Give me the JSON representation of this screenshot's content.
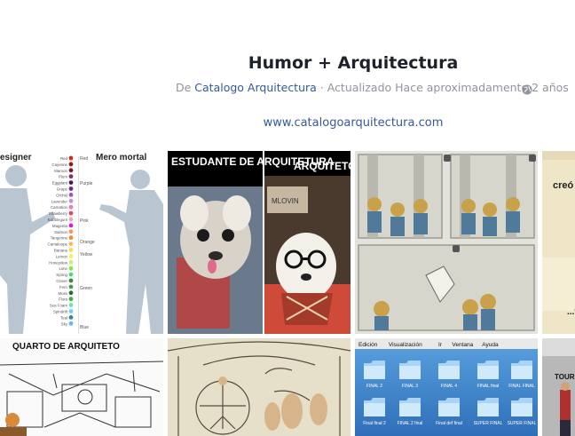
{
  "album": {
    "title": "Humor + Arquitectura",
    "meta_prefix": "De ",
    "author": "Catalogo Arquitectura",
    "meta_suffix": " · Actualizado Hace aproximadamente 2 años",
    "privacy_icon": "globe-icon",
    "website": "www.catalogoarquitectura.com"
  },
  "photos": [
    {
      "labels": [
        "esigner",
        "Mero mortal"
      ],
      "color_names": [
        "Red",
        "Cayenne",
        "Maroon",
        "Plum",
        "Eggplant",
        "Grape",
        "Orchid",
        "Lavender",
        "Carnation",
        "Strawberry",
        "Bubblegum",
        "Magenta",
        "Salmon",
        "Tangerine",
        "Cantaloupe",
        "Banana",
        "Lemon",
        "Honeydew",
        "Lime",
        "Spring",
        "Clover",
        "Fern",
        "Moss",
        "Flora",
        "Sea Foam",
        "Spindrift",
        "Teal",
        "Sky"
      ],
      "right_words": [
        "Red",
        "Purple",
        "Pink",
        "Orange",
        "Yellow",
        "Green",
        "Blue"
      ]
    },
    {
      "left_caption": "ESTUDANTE DE ARQUITETURA",
      "right_caption": "ARQUITETO",
      "sign_text": "MLOVIN"
    },
    {
      "description": "comic"
    },
    {
      "caption": "creó",
      "footer": "...f"
    },
    {
      "caption": "QUARTO DE ARQUITETO"
    },
    {
      "description": "sketch"
    },
    {
      "menu": [
        "Edición",
        "Visualización",
        "Ir",
        "Ventana",
        "Ayuda"
      ],
      "folders_row1": [
        "FINAL 2",
        "FINAL 3",
        "FINAL 4",
        "FINAL final",
        "FINAL FINAL"
      ],
      "folders_row2": [
        "Final final 2",
        "FINAL 2 final",
        "Final def final",
        "SUPER FINAL",
        "SUPER FINAL"
      ]
    },
    {
      "caption": "TOURIST"
    }
  ],
  "colors": {
    "text": "#1d2129",
    "meta": "#90949c",
    "link": "#365899"
  }
}
